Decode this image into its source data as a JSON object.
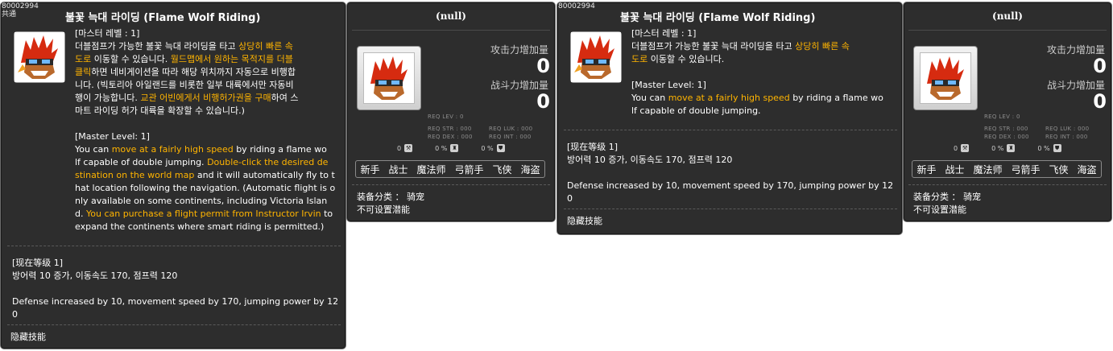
{
  "skill_id": "80002994",
  "tag": "共通",
  "title": "불꽃 늑대 라이딩 (Flame Wolf Riding)",
  "master_level_kr": "[마스터 레벨 : 1]",
  "desc_kr_long": [
    [
      {
        "t": "더블점프가 가능한 불꽃 늑대 라이딩을 타고 "
      },
      {
        "t": "상당히 빠른 속",
        "h": 1
      }
    ],
    [
      {
        "t": "도로",
        "h": 1
      },
      {
        "t": " 이동할 수 있습니다. "
      },
      {
        "t": "월드맵에서 원하는 목적지를 더블",
        "h": 1
      }
    ],
    [
      {
        "t": "클릭",
        "h": 1
      },
      {
        "t": "하면 네비게이션을 따라 해당 위치까지 자동으로 비행합"
      }
    ],
    [
      {
        "t": "니다. (빅토리아 아일랜드를 비롯한 일부 대륙에서만 자동비"
      }
    ],
    [
      {
        "t": "행이 가능합니다. "
      },
      {
        "t": "교관 어빈에게서 비행허가권을 구매",
        "h": 1
      },
      {
        "t": "하여 스"
      }
    ],
    [
      {
        "t": "마트 라이딩 허가 대륙을 확장할 수 있습니다.)"
      }
    ]
  ],
  "master_level_en": "[Master Level: 1]",
  "desc_en_long": [
    [
      {
        "t": "You can "
      },
      {
        "t": "move at a fairly high speed",
        "h": 1
      },
      {
        "t": " by riding a flame wo"
      }
    ],
    [
      {
        "t": "lf capable of double jumping. "
      },
      {
        "t": "Double-click the desired de",
        "h": 1
      }
    ],
    [
      {
        "t": "stination on the world map",
        "h": 1
      },
      {
        "t": " and it will automatically fly to t"
      }
    ],
    [
      {
        "t": "hat location following the navigation. (Automatic flight is o"
      }
    ],
    [
      {
        "t": "nly available on some continents, including Victoria Islan"
      }
    ],
    [
      {
        "t": "d. "
      },
      {
        "t": "You can purchase a flight permit from Instructor Irvin",
        "h": 1
      },
      {
        "t": " to"
      }
    ],
    [
      {
        "t": "expand the continents where smart riding is permitted.)"
      }
    ]
  ],
  "desc_kr_short": [
    [
      {
        "t": "더블점프가 가능한 불꽃 늑대 라이딩을 타고 "
      },
      {
        "t": "상당히 빠른 속",
        "h": 1
      }
    ],
    [
      {
        "t": "도로",
        "h": 1
      },
      {
        "t": " 이동할 수 있습니다."
      }
    ]
  ],
  "desc_en_short": [
    [
      {
        "t": "You can "
      },
      {
        "t": "move at a fairly high speed",
        "h": 1
      },
      {
        "t": " by riding a flame wo"
      }
    ],
    [
      {
        "t": "lf capable of double jumping."
      }
    ]
  ],
  "current_level": "[现在等级 1]",
  "effect_kr": "방어력 10 증가, 이동속도 170, 점프력 120",
  "effect_en_1": "Defense increased by 10, movement speed by 170, jumping power by 12",
  "effect_en_2": "0",
  "hidden_skill": "隐藏技能",
  "item": {
    "title": "(null)",
    "atk_label": "攻击力增加量",
    "atk_value": "0",
    "fight_label": "战斗力增加量",
    "fight_value": "0",
    "req_lev": "REQ LEV :    0",
    "req_str": "REQ STR : 000",
    "req_luk": "REQ LUK : 000",
    "req_dex": "REQ DEX : 000",
    "req_int": "REQ INT : 000",
    "req_icons": [
      {
        "val": "0",
        "icon": "wrench-icon"
      },
      {
        "val": "0 %",
        "icon": "helmet-icon"
      },
      {
        "val": "0 %",
        "icon": "shield-icon"
      }
    ],
    "jobs": [
      "新手",
      "战士",
      "魔法师",
      "弓箭手",
      "飞侠",
      "海盗"
    ],
    "category": "装备分类 ： 骑宠",
    "potential": "不可设置潜能"
  }
}
